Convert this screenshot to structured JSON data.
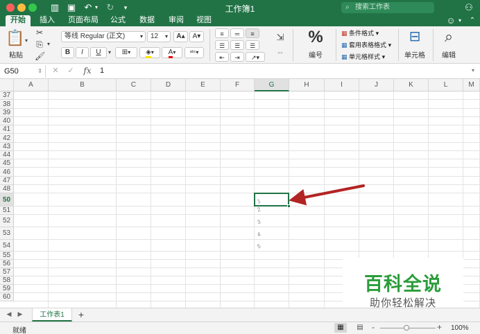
{
  "window": {
    "title": "工作簿1",
    "search_placeholder": "搜索工作表"
  },
  "ribbon_tabs": [
    "开始",
    "插入",
    "页面布局",
    "公式",
    "数据",
    "审阅",
    "视图"
  ],
  "ribbon": {
    "paste_label": "粘贴",
    "font_name": "等线 Regular (正文)",
    "font_size": "12",
    "bold": "B",
    "italic": "I",
    "underline": "U",
    "number_label": "编号",
    "conditional_format": "条件格式",
    "format_as_table": "套用表格格式",
    "cell_styles": "单元格样式",
    "cells_label": "单元格",
    "editing_label": "编辑"
  },
  "formula_bar": {
    "name_box": "G50",
    "content": "1"
  },
  "columns": [
    "A",
    "B",
    "C",
    "D",
    "E",
    "F",
    "G",
    "H",
    "I",
    "J",
    "K",
    "L",
    "M"
  ],
  "rows": [
    "37",
    "38",
    "39",
    "40",
    "41",
    "42",
    "43",
    "44",
    "45",
    "46",
    "47",
    "48",
    "50",
    "51",
    "52",
    "53",
    "54",
    "55",
    "56",
    "57",
    "58",
    "59",
    "60"
  ],
  "selected_cell": {
    "column": "G",
    "row": "50"
  },
  "cells": [
    {
      "row": "50",
      "column": "G",
      "value": "1"
    },
    {
      "row": "51",
      "column": "G",
      "value": "2"
    },
    {
      "row": "52",
      "column": "G",
      "value": "3"
    },
    {
      "row": "53",
      "column": "G",
      "value": "4"
    },
    {
      "row": "54",
      "column": "G",
      "value": "5"
    }
  ],
  "sheet_tabs": [
    "工作表1"
  ],
  "add_sheet": "+",
  "status": {
    "ready": "就绪",
    "zoom_minus": "-",
    "zoom_plus": "+",
    "zoom": "100%"
  },
  "watermark": {
    "title": "百科全说",
    "subtitle": "助你轻松解决"
  },
  "colors": {
    "brand": "#217346",
    "arrow": "#b32424",
    "watermark": "#2a9d3a"
  }
}
